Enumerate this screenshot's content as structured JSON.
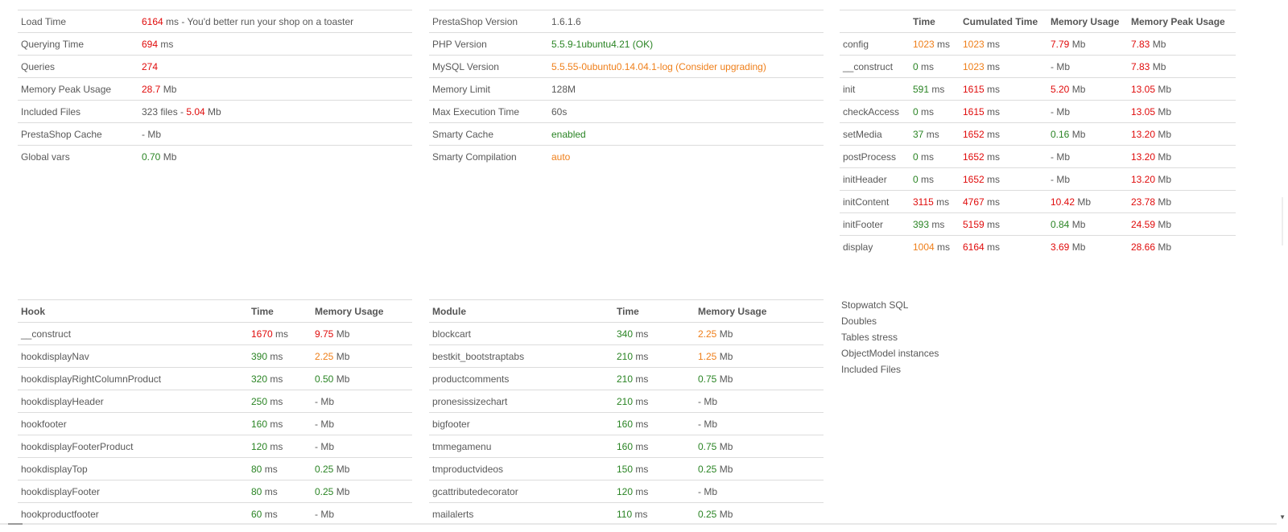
{
  "summary": [
    {
      "label": "Load Time",
      "value": "6164",
      "value_color": "red",
      "suffix": " ms - You'd better run your shop on a toaster"
    },
    {
      "label": "Querying Time",
      "value": "694",
      "value_color": "red",
      "suffix": " ms"
    },
    {
      "label": "Queries",
      "value": "274",
      "value_color": "red",
      "suffix": ""
    },
    {
      "label": "Memory Peak Usage",
      "value": "28.7",
      "value_color": "red",
      "suffix": " Mb"
    },
    {
      "label": "Included Files",
      "prefix": "323 files - ",
      "value": "5.04",
      "value_color": "red",
      "suffix": " Mb"
    },
    {
      "label": "PrestaShop Cache",
      "value": "-",
      "value_color": "grey",
      "suffix": " Mb"
    },
    {
      "label": "Global vars",
      "value": "0.70",
      "value_color": "green",
      "suffix": " Mb"
    }
  ],
  "config": [
    {
      "label": "PrestaShop Version",
      "value": "1.6.1.6",
      "value_color": "grey"
    },
    {
      "label": "PHP Version",
      "value": "5.5.9-1ubuntu4.21 (OK)",
      "value_color": "green"
    },
    {
      "label": "MySQL Version",
      "value": "5.5.55-0ubuntu0.14.04.1-log (Consider upgrading)",
      "value_color": "orange"
    },
    {
      "label": "Memory Limit",
      "value": "128M",
      "value_color": "grey"
    },
    {
      "label": "Max Execution Time",
      "value": "60s",
      "value_color": "grey"
    },
    {
      "label": "Smarty Cache",
      "value": "enabled",
      "value_color": "green"
    },
    {
      "label": "Smarty Compilation",
      "value": "auto",
      "value_color": "orange"
    }
  ],
  "steps": {
    "headers": [
      "",
      "Time",
      "Cumulated Time",
      "Memory Usage",
      "Memory Peak Usage"
    ],
    "rows": [
      {
        "name": "config",
        "time": "1023",
        "time_color": "orange",
        "cumul": "1023",
        "cumul_color": "orange",
        "mem": "7.79",
        "mem_color": "red",
        "peak": "7.83",
        "peak_color": "red"
      },
      {
        "name": "__construct",
        "time": "0",
        "time_color": "green",
        "cumul": "1023",
        "cumul_color": "orange",
        "mem": "-",
        "mem_color": "grey",
        "peak": "7.83",
        "peak_color": "red"
      },
      {
        "name": "init",
        "time": "591",
        "time_color": "green",
        "cumul": "1615",
        "cumul_color": "red",
        "mem": "5.20",
        "mem_color": "red",
        "peak": "13.05",
        "peak_color": "red"
      },
      {
        "name": "checkAccess",
        "time": "0",
        "time_color": "green",
        "cumul": "1615",
        "cumul_color": "red",
        "mem": "-",
        "mem_color": "grey",
        "peak": "13.05",
        "peak_color": "red"
      },
      {
        "name": "setMedia",
        "time": "37",
        "time_color": "green",
        "cumul": "1652",
        "cumul_color": "red",
        "mem": "0.16",
        "mem_color": "green",
        "peak": "13.20",
        "peak_color": "red"
      },
      {
        "name": "postProcess",
        "time": "0",
        "time_color": "green",
        "cumul": "1652",
        "cumul_color": "red",
        "mem": "-",
        "mem_color": "grey",
        "peak": "13.20",
        "peak_color": "red"
      },
      {
        "name": "initHeader",
        "time": "0",
        "time_color": "green",
        "cumul": "1652",
        "cumul_color": "red",
        "mem": "-",
        "mem_color": "grey",
        "peak": "13.20",
        "peak_color": "red"
      },
      {
        "name": "initContent",
        "time": "3115",
        "time_color": "red",
        "cumul": "4767",
        "cumul_color": "red",
        "mem": "10.42",
        "mem_color": "red",
        "peak": "23.78",
        "peak_color": "red"
      },
      {
        "name": "initFooter",
        "time": "393",
        "time_color": "green",
        "cumul": "5159",
        "cumul_color": "red",
        "mem": "0.84",
        "mem_color": "green",
        "peak": "24.59",
        "peak_color": "red"
      },
      {
        "name": "display",
        "time": "1004",
        "time_color": "orange",
        "cumul": "6164",
        "cumul_color": "red",
        "mem": "3.69",
        "mem_color": "red",
        "peak": "28.66",
        "peak_color": "red"
      }
    ]
  },
  "hooks": {
    "headers": [
      "Hook",
      "Time",
      "Memory Usage"
    ],
    "rows": [
      {
        "name": "__construct",
        "time": "1670",
        "time_color": "red",
        "mem": "9.75",
        "mem_color": "red"
      },
      {
        "name": "hookdisplayNav",
        "time": "390",
        "time_color": "green",
        "mem": "2.25",
        "mem_color": "orange"
      },
      {
        "name": "hookdisplayRightColumnProduct",
        "time": "320",
        "time_color": "green",
        "mem": "0.50",
        "mem_color": "green"
      },
      {
        "name": "hookdisplayHeader",
        "time": "250",
        "time_color": "green",
        "mem": "-",
        "mem_color": "grey"
      },
      {
        "name": "hookfooter",
        "time": "160",
        "time_color": "green",
        "mem": "-",
        "mem_color": "grey"
      },
      {
        "name": "hookdisplayFooterProduct",
        "time": "120",
        "time_color": "green",
        "mem": "-",
        "mem_color": "grey"
      },
      {
        "name": "hookdisplayTop",
        "time": "80",
        "time_color": "green",
        "mem": "0.25",
        "mem_color": "green"
      },
      {
        "name": "hookdisplayFooter",
        "time": "80",
        "time_color": "green",
        "mem": "0.25",
        "mem_color": "green"
      },
      {
        "name": "hookproductfooter",
        "time": "60",
        "time_color": "green",
        "mem": "-",
        "mem_color": "grey"
      }
    ]
  },
  "modules": {
    "headers": [
      "Module",
      "Time",
      "Memory Usage"
    ],
    "rows": [
      {
        "name": "blockcart",
        "time": "340",
        "time_color": "green",
        "mem": "2.25",
        "mem_color": "orange"
      },
      {
        "name": "bestkit_bootstraptabs",
        "time": "210",
        "time_color": "green",
        "mem": "1.25",
        "mem_color": "orange"
      },
      {
        "name": "productcomments",
        "time": "210",
        "time_color": "green",
        "mem": "0.75",
        "mem_color": "green"
      },
      {
        "name": "pronesissizechart",
        "time": "210",
        "time_color": "green",
        "mem": "-",
        "mem_color": "grey"
      },
      {
        "name": "bigfooter",
        "time": "160",
        "time_color": "green",
        "mem": "-",
        "mem_color": "grey"
      },
      {
        "name": "tmmegamenu",
        "time": "160",
        "time_color": "green",
        "mem": "0.75",
        "mem_color": "green"
      },
      {
        "name": "tmproductvideos",
        "time": "150",
        "time_color": "green",
        "mem": "0.25",
        "mem_color": "green"
      },
      {
        "name": "gcattributedecorator",
        "time": "120",
        "time_color": "green",
        "mem": "-",
        "mem_color": "grey"
      },
      {
        "name": "mailalerts",
        "time": "110",
        "time_color": "green",
        "mem": "0.25",
        "mem_color": "green"
      }
    ]
  },
  "units": {
    "ms": " ms",
    "mb": " Mb"
  },
  "links": [
    "Stopwatch SQL",
    "Doubles",
    "Tables stress",
    "ObjectModel instances",
    "Included Files"
  ]
}
